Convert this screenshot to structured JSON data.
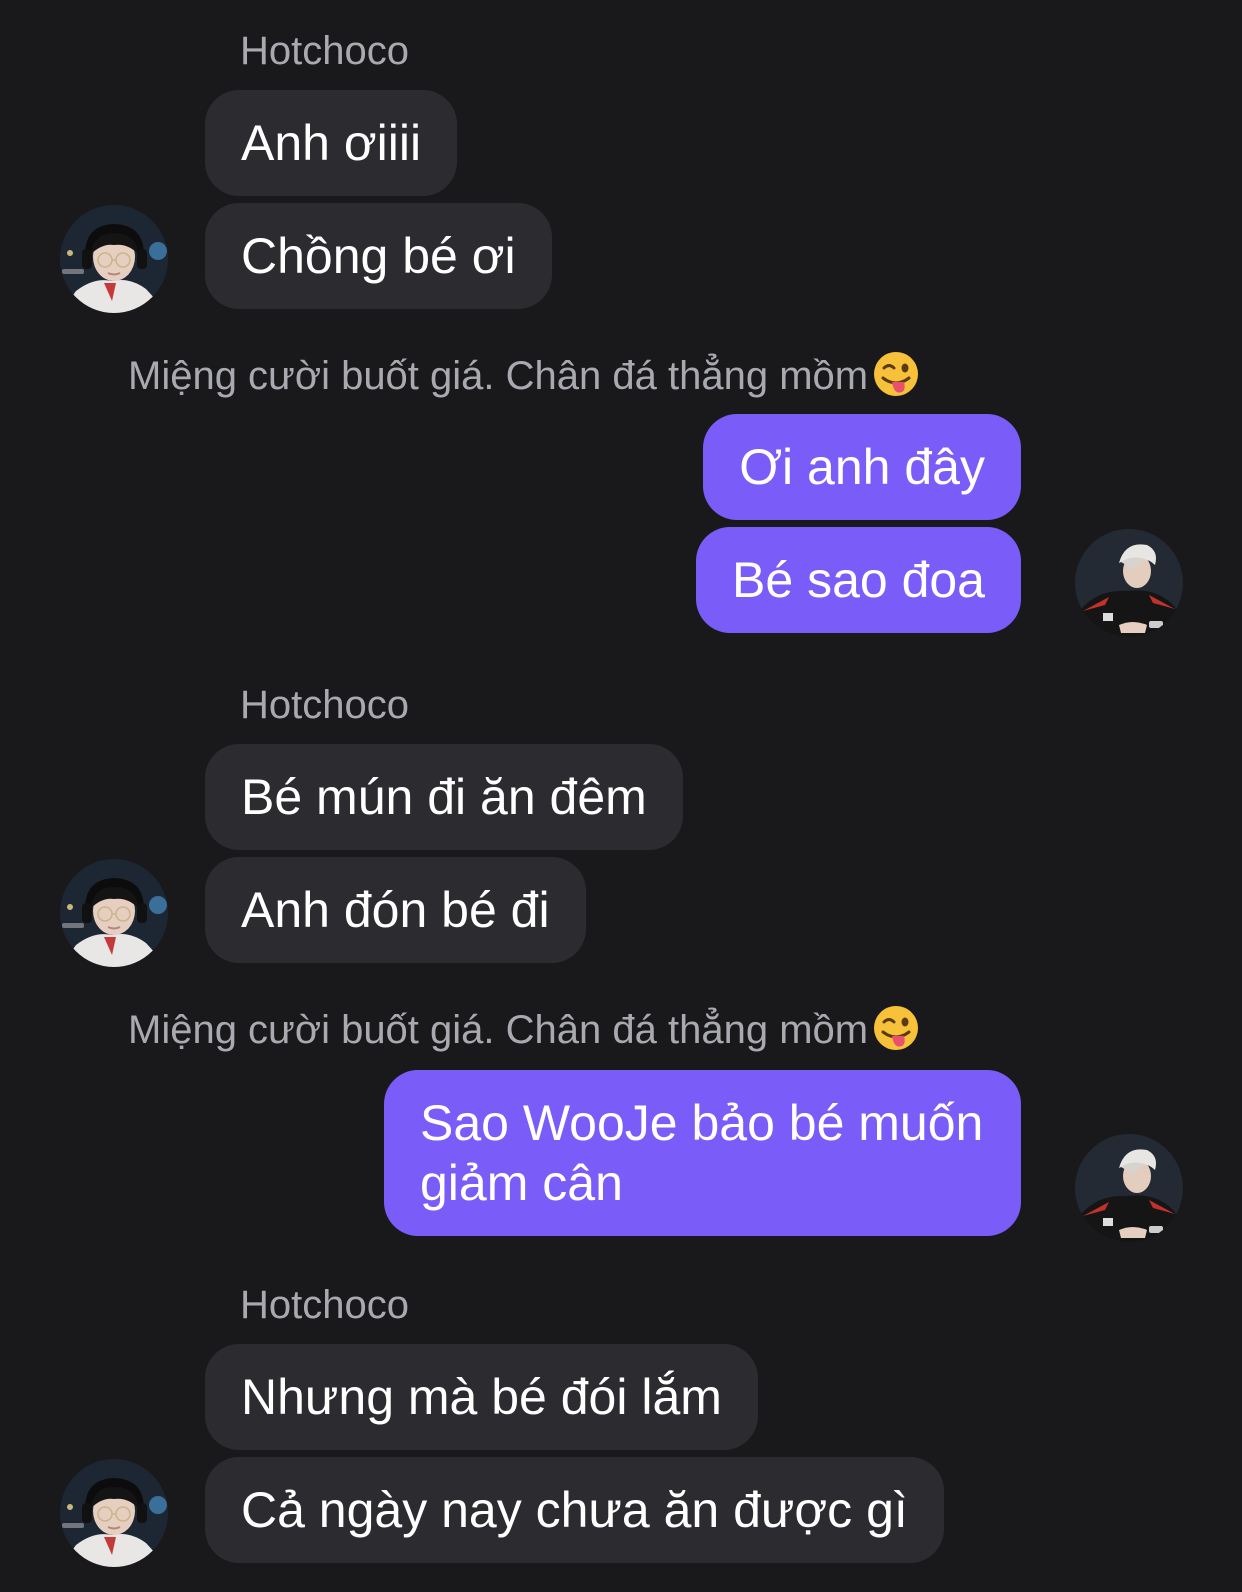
{
  "conversation": {
    "groups": [
      {
        "side": "incoming",
        "sender": "Hotchoco",
        "messages": [
          "Anh ơiiii",
          "Chồng bé ơi"
        ]
      },
      {
        "side": "outgoing",
        "sender": "Miệng cười buốt giá. Chân đá thẳng mồm",
        "sender_emoji": "winking-tongue-emoji",
        "messages": [
          "Ơi anh đây",
          "Bé sao đoa"
        ]
      },
      {
        "side": "incoming",
        "sender": "Hotchoco",
        "messages": [
          "Bé mún đi ăn đêm",
          "Anh đón bé đi"
        ]
      },
      {
        "side": "outgoing",
        "sender": "Miệng cười buốt giá. Chân đá thẳng mồm",
        "sender_emoji": "winking-tongue-emoji",
        "messages": [
          "Sao WooJe bảo bé muốn giảm cân"
        ]
      },
      {
        "side": "incoming",
        "sender": "Hotchoco",
        "messages": [
          "Nhưng mà bé đói lắm",
          "Cả ngày nay chưa ăn được gì"
        ]
      }
    ]
  },
  "colors": {
    "background": "#19191c",
    "incoming_bubble": "#2c2c30",
    "outgoing_bubble": "#7a5cf9",
    "sender_name": "#a9a9b0",
    "message_text": "#ffffff"
  }
}
